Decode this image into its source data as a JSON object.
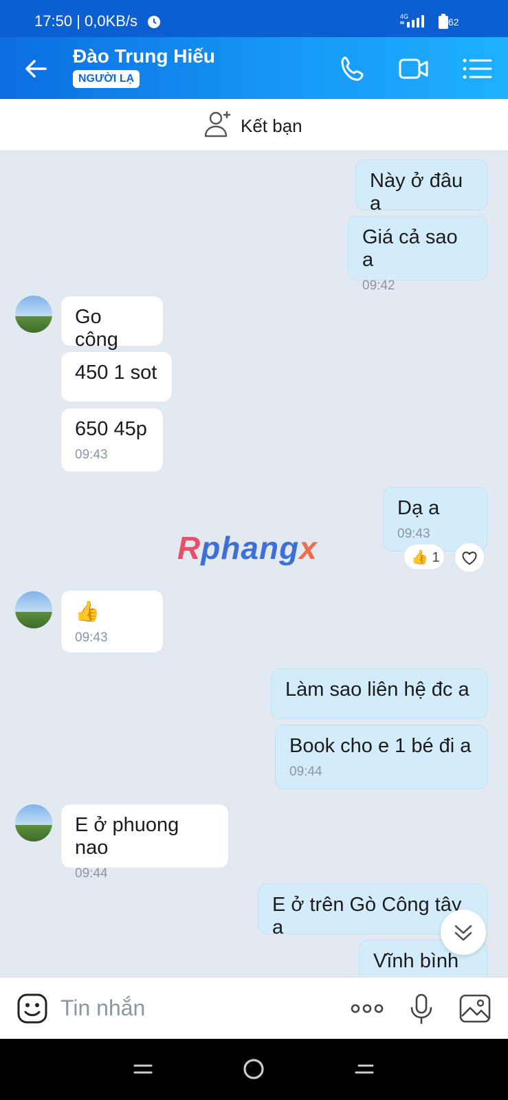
{
  "status_bar": {
    "time": "17:50 | 0,0KB/s",
    "network": "4G",
    "battery": "62"
  },
  "header": {
    "contact_name": "Đào Trung Hiếu",
    "badge": "NGƯỜI LẠ"
  },
  "add_friend": {
    "label": "Kết bạn"
  },
  "messages": [
    {
      "from": "me",
      "text": "Này ở đâu a"
    },
    {
      "from": "me",
      "text": "Giá cả sao a",
      "time": "09:42"
    },
    {
      "from": "them",
      "text": "Go công"
    },
    {
      "from": "them",
      "text": "450 1 sot"
    },
    {
      "from": "them",
      "text": "650 45p",
      "time": "09:43"
    },
    {
      "from": "me",
      "text": "Dạ a",
      "time": "09:43",
      "reaction": "👍",
      "reaction_count": "1"
    },
    {
      "from": "them",
      "text": "👍",
      "time": "09:43"
    },
    {
      "from": "me",
      "text": "Làm sao liên hệ đc a"
    },
    {
      "from": "me",
      "text": "Book cho e 1 bé đi a",
      "time": "09:44"
    },
    {
      "from": "them",
      "text": "E ở phuong nao",
      "time": "09:44"
    },
    {
      "from": "me",
      "text": "E ở trên Gò Công tây a"
    },
    {
      "from": "me",
      "text": "Vĩnh bình a"
    }
  ],
  "watermark": {
    "r": "R",
    "mid": "phang",
    "x": "x"
  },
  "input": {
    "placeholder": "Tin nhắn"
  },
  "colors": {
    "header_start": "#0c6ee0",
    "header_end": "#1fb0ff",
    "my_bubble": "#d3ecfc",
    "their_bubble": "#ffffff",
    "chat_bg": "#e2e9f1"
  }
}
